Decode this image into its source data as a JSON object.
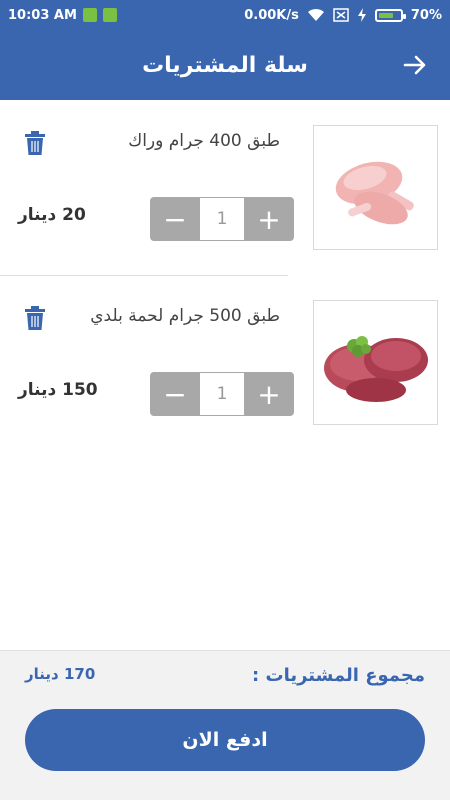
{
  "status_bar": {
    "time": "10:03 AM",
    "network_speed": "0.00K/s",
    "battery_percent": "70%",
    "battery_level": 0.7
  },
  "app_bar": {
    "title": "سلة المشتريات"
  },
  "items": [
    {
      "name": "طبق 400 جرام وراك",
      "quantity": "1",
      "price": "20 دينار"
    },
    {
      "name": "طبق 500 جرام لحمة بلدي",
      "quantity": "1",
      "price": "150 دينار"
    }
  ],
  "stepper": {
    "minus": "−",
    "plus": "+"
  },
  "footer": {
    "total_label": "مجموع المشتريات :",
    "total_value": "170 دينار",
    "pay_label": "ادفع الان"
  },
  "colors": {
    "primary": "#3a66b0",
    "stepper": "#a8a8a8"
  }
}
